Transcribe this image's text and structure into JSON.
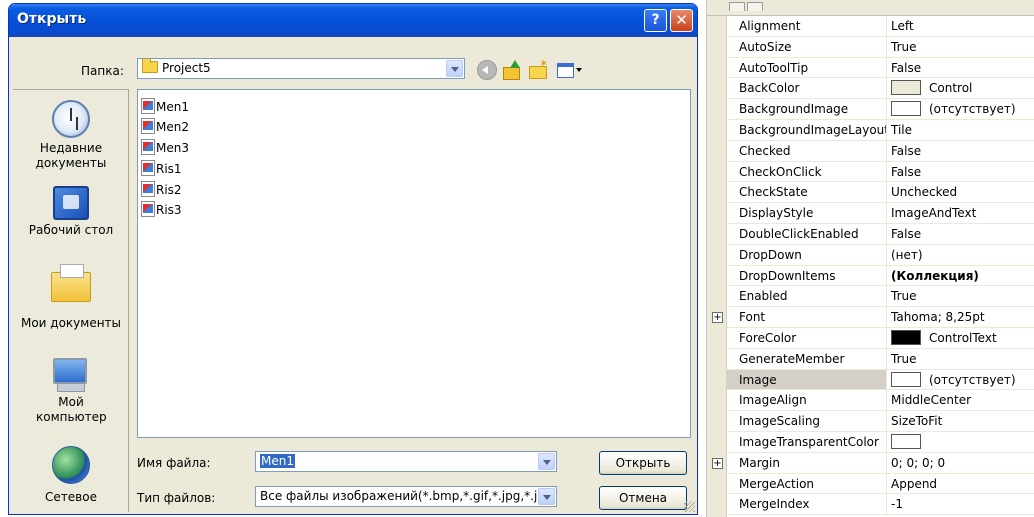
{
  "dialog": {
    "title": "Открыть",
    "help_glyph": "?",
    "close_glyph": "✕",
    "folder_label": "Папка:",
    "folder_value": "Project5",
    "places": [
      {
        "label": "Недавние документы",
        "icon": "recent-documents-icon"
      },
      {
        "label": "Рабочий стол",
        "icon": "desktop-icon"
      },
      {
        "label": "Мои документы",
        "icon": "my-documents-icon"
      },
      {
        "label": "Мой компьютер",
        "icon": "my-computer-icon"
      },
      {
        "label": "Сетевое",
        "icon": "network-icon"
      }
    ],
    "files": [
      "Men1",
      "Men2",
      "Men3",
      "Ris1",
      "Ris2",
      "Ris3"
    ],
    "filename_label": "Имя файла:",
    "filename_value": "Men1",
    "filetype_label": "Тип файлов:",
    "filetype_value": "Все файлы изображений(*.bmp,*.gif,*.jpg,*.jp",
    "open_button": "Открыть",
    "cancel_button": "Отмена"
  },
  "properties": {
    "rows": [
      {
        "name": "Alignment",
        "value": "Left"
      },
      {
        "name": "AutoSize",
        "value": "True"
      },
      {
        "name": "AutoToolTip",
        "value": "False"
      },
      {
        "name": "BackColor",
        "value": "Control",
        "swatch": "#ece9d8"
      },
      {
        "name": "BackgroundImage",
        "value": "(отсутствует)",
        "swatch": "#ffffff"
      },
      {
        "name": "BackgroundImageLayout",
        "value": "Tile"
      },
      {
        "name": "Checked",
        "value": "False"
      },
      {
        "name": "CheckOnClick",
        "value": "False"
      },
      {
        "name": "CheckState",
        "value": "Unchecked"
      },
      {
        "name": "DisplayStyle",
        "value": "ImageAndText"
      },
      {
        "name": "DoubleClickEnabled",
        "value": "False"
      },
      {
        "name": "DropDown",
        "value": "(нет)"
      },
      {
        "name": "DropDownItems",
        "value": "(Коллекция)",
        "bold": true
      },
      {
        "name": "Enabled",
        "value": "True"
      },
      {
        "name": "Font",
        "value": "Tahoma; 8,25pt",
        "expandable": true
      },
      {
        "name": "ForeColor",
        "value": "ControlText",
        "swatch": "#000000"
      },
      {
        "name": "GenerateMember",
        "value": "True"
      },
      {
        "name": "Image",
        "value": "(отсутствует)",
        "swatch": "#ffffff",
        "selected": true
      },
      {
        "name": "ImageAlign",
        "value": "MiddleCenter"
      },
      {
        "name": "ImageScaling",
        "value": "SizeToFit"
      },
      {
        "name": "ImageTransparentColor",
        "value": "",
        "swatch": "#ffffff"
      },
      {
        "name": "Margin",
        "value": "0; 0; 0; 0",
        "expandable": true
      },
      {
        "name": "MergeAction",
        "value": "Append"
      },
      {
        "name": "MergeIndex",
        "value": "-1"
      }
    ]
  }
}
